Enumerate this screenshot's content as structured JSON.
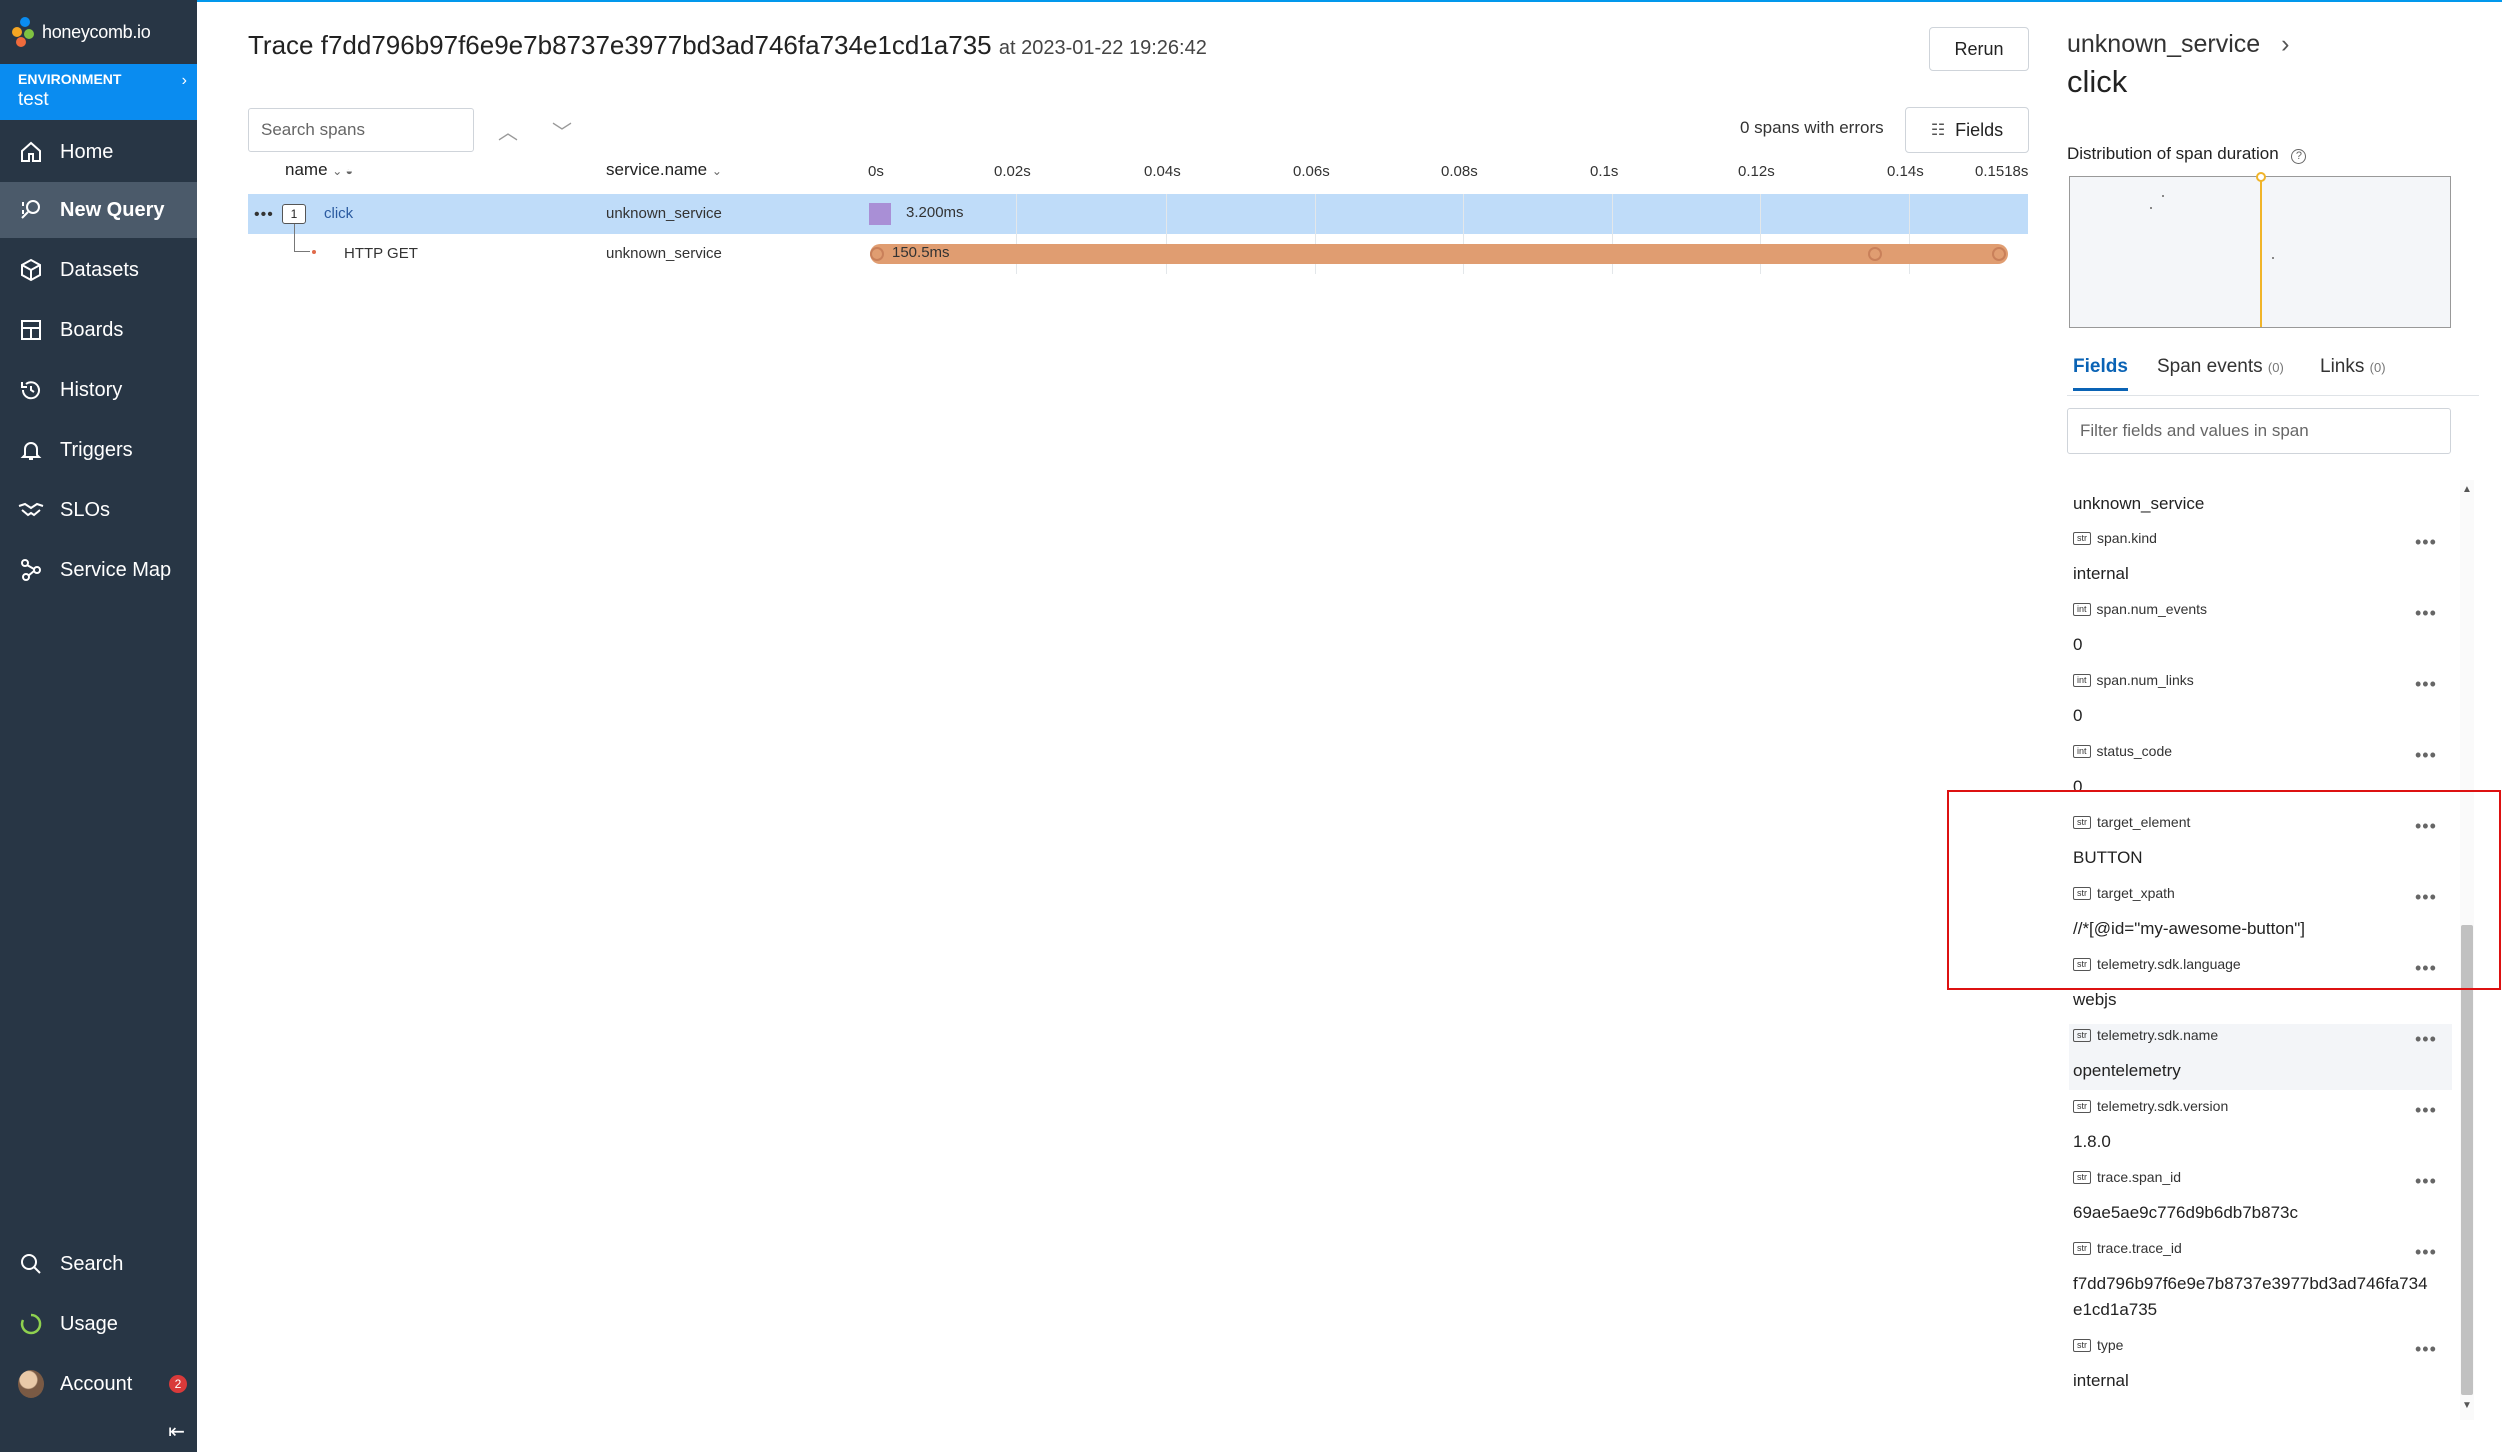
{
  "colors": {
    "sidebar_bg": "#283645",
    "env_bg": "#0a8cf0",
    "selected_row": "#bfdcf9",
    "click_bar": "#a98fd6",
    "http_bar": "#e09d71",
    "accent": "#0a63b5",
    "highlight_box": "#dd1111"
  },
  "sidebar": {
    "logo": "honeycomb.io",
    "environment": {
      "label": "ENVIRONMENT",
      "value": "test"
    },
    "items": [
      {
        "label": "Home",
        "icon": "home-icon"
      },
      {
        "label": "New Query",
        "icon": "query-icon"
      },
      {
        "label": "Datasets",
        "icon": "cube-icon"
      },
      {
        "label": "Boards",
        "icon": "boards-icon"
      },
      {
        "label": "History",
        "icon": "history-icon"
      },
      {
        "label": "Triggers",
        "icon": "bell-icon"
      },
      {
        "label": "SLOs",
        "icon": "handshake-icon"
      },
      {
        "label": "Service Map",
        "icon": "service-map-icon"
      }
    ],
    "bottom": [
      {
        "label": "Search",
        "icon": "search-icon"
      },
      {
        "label": "Usage",
        "icon": "usage-icon"
      },
      {
        "label": "Account",
        "icon": "avatar",
        "badge": "2"
      }
    ]
  },
  "trace": {
    "title": "Trace f7dd796b97f6e9e7b8737e3977bd3ad746fa734e1cd1a735",
    "at": "at 2023-01-22 19:26:42",
    "rerun": "Rerun",
    "search_placeholder": "Search spans",
    "errors": "0 spans with errors",
    "fields_button": "Fields",
    "columns": {
      "name": "name",
      "service": "service.name"
    },
    "ticks": [
      "0s",
      "0.02s",
      "0.04s",
      "0.06s",
      "0.08s",
      "0.1s",
      "0.12s",
      "0.14s",
      "0.1518s"
    ],
    "rows": [
      {
        "count": "1",
        "name": "click",
        "service": "unknown_service",
        "duration": "3.200ms"
      },
      {
        "name": "HTTP GET",
        "service": "unknown_service",
        "duration": "150.5ms"
      }
    ]
  },
  "panel": {
    "service": "unknown_service",
    "span": "click",
    "distribution_label": "Distribution of span duration",
    "tabs": [
      {
        "label": "Fields",
        "count": ""
      },
      {
        "label": "Span events",
        "count": "(0)"
      },
      {
        "label": "Links",
        "count": "(0)"
      }
    ],
    "filter_placeholder": "Filter fields and values in span",
    "top_value": "unknown_service",
    "fields": [
      {
        "type": "str",
        "name": "span.kind",
        "value": "internal"
      },
      {
        "type": "int",
        "name": "span.num_events",
        "value": "0"
      },
      {
        "type": "int",
        "name": "span.num_links",
        "value": "0"
      },
      {
        "type": "int",
        "name": "status_code",
        "value": "0"
      },
      {
        "type": "str",
        "name": "target_element",
        "value": "BUTTON"
      },
      {
        "type": "str",
        "name": "target_xpath",
        "value": "//*[@id=\"my-awesome-button\"]"
      },
      {
        "type": "str",
        "name": "telemetry.sdk.language",
        "value": "webjs"
      },
      {
        "type": "str",
        "name": "telemetry.sdk.name",
        "value": "opentelemetry"
      },
      {
        "type": "str",
        "name": "telemetry.sdk.version",
        "value": "1.8.0"
      },
      {
        "type": "str",
        "name": "trace.span_id",
        "value": "69ae5ae9c776d9b6db7b873c"
      },
      {
        "type": "str",
        "name": "trace.trace_id",
        "value": "f7dd796b97f6e9e7b8737e3977bd3ad746fa734",
        "value2": "e1cd1a735"
      },
      {
        "type": "str",
        "name": "type",
        "value": "internal"
      }
    ]
  }
}
